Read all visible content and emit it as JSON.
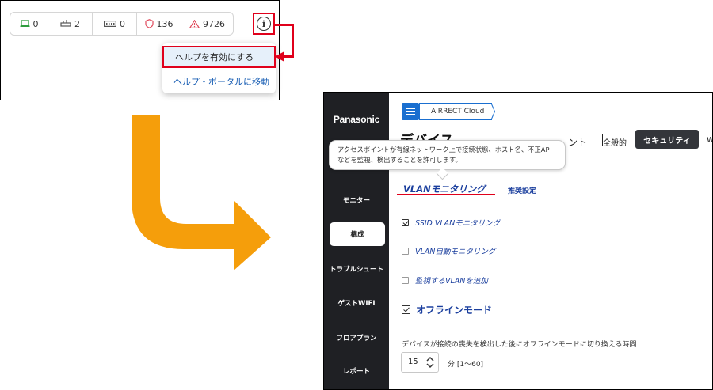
{
  "status_bar": {
    "items": [
      {
        "icon": "laptop-icon",
        "count": "0",
        "color": "#2e9e3e"
      },
      {
        "icon": "switch-icon",
        "count": "2",
        "color": "#555555"
      },
      {
        "icon": "device-icon",
        "count": "0",
        "color": "#555555"
      },
      {
        "icon": "shield-icon",
        "count": "136",
        "color": "#e0485a"
      },
      {
        "icon": "warning-icon",
        "count": "9726",
        "color": "#e0485a"
      }
    ]
  },
  "info_button": {
    "icon": "info-icon",
    "glyph": "i"
  },
  "help_menu": {
    "items": [
      {
        "label": "ヘルプを有効にする"
      },
      {
        "label": "ヘルプ・ポータルに移動"
      }
    ]
  },
  "app": {
    "brand": "Panasonic",
    "sidebar": {
      "items": [
        {
          "label": "モニター"
        },
        {
          "label": "構成"
        },
        {
          "label": "トラブルシュート"
        },
        {
          "label": "ゲストWIFI"
        },
        {
          "label": "フロアプラン"
        },
        {
          "label": "レポート"
        }
      ]
    },
    "breadcrumb": "AIRRECT Cloud",
    "page_title": "デバイス",
    "page_title_suffix": "ント",
    "tabs": {
      "general": "全般的",
      "security": "セキュリティ",
      "overflow": "W"
    },
    "tooltip": {
      "line1": "アクセスポイントが有線ネットワーク上で接続状態、ホスト名、不正AP",
      "line2": "などを監視、検出することを許可します。"
    },
    "subtabs": {
      "vlan": "VLANモニタリング",
      "recommended": "推奨設定"
    },
    "checkboxes": [
      {
        "label": "SSID VLANモニタリング",
        "checked": true
      },
      {
        "label": "VLAN自動モニタリング",
        "checked": false
      },
      {
        "label": "監視するVLANを追加",
        "checked": false
      }
    ],
    "offline": {
      "label": "オフラインモード",
      "checked": true,
      "description": "デバイスが接続の喪失を検出した後にオフラインモードに切り換える時間",
      "value": "15",
      "unit": "分 [1〜60]"
    }
  },
  "colors": {
    "accent_red": "#e0001b",
    "link_blue": "#1b3f9e",
    "sidebar_bg": "#1f2024",
    "arrow_orange": "#f59e0b"
  }
}
